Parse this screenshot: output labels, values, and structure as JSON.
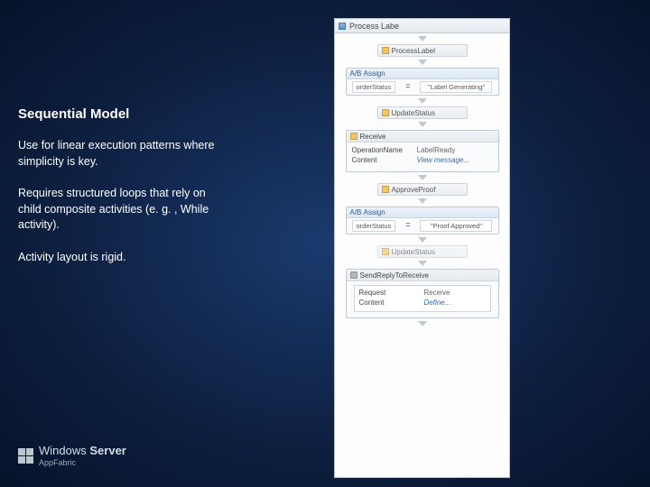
{
  "left": {
    "title": "Sequential Model",
    "para1": "Use for linear execution patterns where simplicity is key.",
    "para2": "Requires structured loops that rely on child composite activities (e. g. , While activity).",
    "para3": "Activity layout is rigid."
  },
  "logo": {
    "brand_prefix": "Windows",
    "brand_suffix": "Server",
    "sub": "AppFabric"
  },
  "wf": {
    "title": "Process Labe",
    "process_label": "ProcessLabel",
    "assign_header": "Assign",
    "assign1_left": "orderStatus",
    "assign1_eq": "=",
    "assign1_right": "\"Label Generating\"",
    "update_status": "UpdateStatus",
    "receive_header": "Receive",
    "op_key": "OperationName",
    "op_val": "LabelReady",
    "content_key": "Content",
    "content_val": "View message...",
    "approve_proof": "ApproveProof",
    "assign2_left": "orderStatus",
    "assign2_eq": "=",
    "assign2_right": "\"Proof Approved\"",
    "update_status2": "UpdateStatus",
    "sendreply_header": "SendReplyToReceive",
    "request_key": "Request",
    "request_val": "Receive",
    "content2_val": "Define..."
  }
}
